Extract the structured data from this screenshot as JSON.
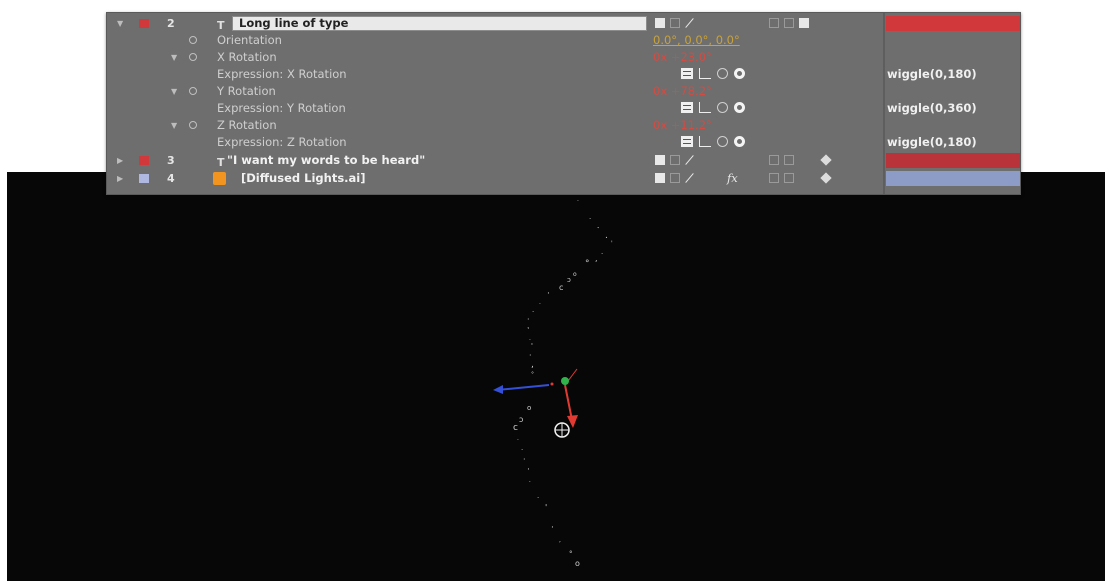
{
  "timeline": {
    "layers": [
      {
        "number": "2",
        "name": "Long line of type",
        "color": "#d0383b",
        "bar_color": "#d0383b"
      },
      {
        "number": "3",
        "name": "\"I want my words to be heard\"",
        "color": "#d0383b",
        "bar_color": "#b8333a"
      },
      {
        "number": "4",
        "name": "[Diffused Lights.ai]",
        "color": "#aeb8e0",
        "bar_color": "#8d9cc6",
        "fx": "fx"
      }
    ],
    "properties": {
      "orientation": {
        "label": "Orientation",
        "value": "0.0°, 0.0°, 0.0°"
      },
      "x_rotation": {
        "label": "X Rotation",
        "value": "0x +23.0°"
      },
      "x_expr": {
        "label": "Expression: X Rotation",
        "expression": "wiggle(0,180)"
      },
      "y_rotation": {
        "label": "Y Rotation",
        "value": "0x +78.2°"
      },
      "y_expr": {
        "label": "Expression: Y Rotation",
        "expression": "wiggle(0,360)"
      },
      "z_rotation": {
        "label": "Z Rotation",
        "value": "0x +11.2°"
      },
      "z_expr": {
        "label": "Expression: Z Rotation",
        "expression": "wiggle(0,180)"
      }
    }
  },
  "viewer": {
    "background": "#070707",
    "gizmo": {
      "x_axis": "#e03a32",
      "y_axis": "#2fb34a",
      "z_axis": "#3450d8"
    }
  }
}
